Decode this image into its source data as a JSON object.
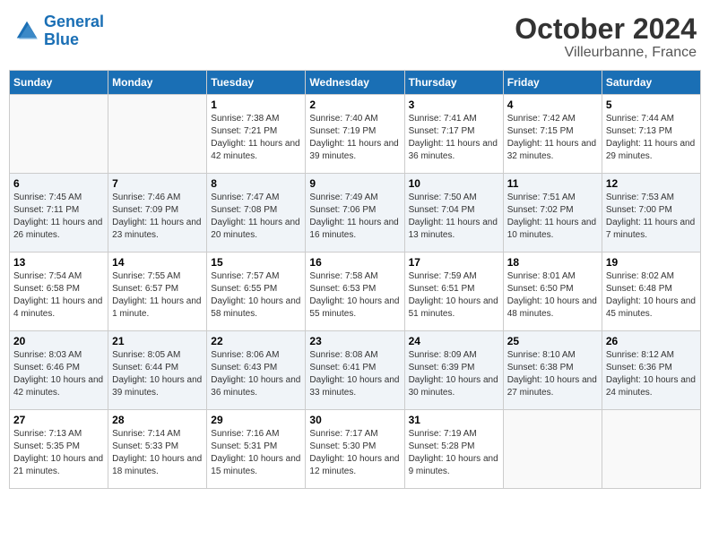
{
  "header": {
    "logo_line1": "General",
    "logo_line2": "Blue",
    "month": "October 2024",
    "location": "Villeurbanne, France"
  },
  "weekdays": [
    "Sunday",
    "Monday",
    "Tuesday",
    "Wednesday",
    "Thursday",
    "Friday",
    "Saturday"
  ],
  "weeks": [
    [
      {
        "day": "",
        "sunrise": "",
        "sunset": "",
        "daylight": ""
      },
      {
        "day": "",
        "sunrise": "",
        "sunset": "",
        "daylight": ""
      },
      {
        "day": "1",
        "sunrise": "Sunrise: 7:38 AM",
        "sunset": "Sunset: 7:21 PM",
        "daylight": "Daylight: 11 hours and 42 minutes."
      },
      {
        "day": "2",
        "sunrise": "Sunrise: 7:40 AM",
        "sunset": "Sunset: 7:19 PM",
        "daylight": "Daylight: 11 hours and 39 minutes."
      },
      {
        "day": "3",
        "sunrise": "Sunrise: 7:41 AM",
        "sunset": "Sunset: 7:17 PM",
        "daylight": "Daylight: 11 hours and 36 minutes."
      },
      {
        "day": "4",
        "sunrise": "Sunrise: 7:42 AM",
        "sunset": "Sunset: 7:15 PM",
        "daylight": "Daylight: 11 hours and 32 minutes."
      },
      {
        "day": "5",
        "sunrise": "Sunrise: 7:44 AM",
        "sunset": "Sunset: 7:13 PM",
        "daylight": "Daylight: 11 hours and 29 minutes."
      }
    ],
    [
      {
        "day": "6",
        "sunrise": "Sunrise: 7:45 AM",
        "sunset": "Sunset: 7:11 PM",
        "daylight": "Daylight: 11 hours and 26 minutes."
      },
      {
        "day": "7",
        "sunrise": "Sunrise: 7:46 AM",
        "sunset": "Sunset: 7:09 PM",
        "daylight": "Daylight: 11 hours and 23 minutes."
      },
      {
        "day": "8",
        "sunrise": "Sunrise: 7:47 AM",
        "sunset": "Sunset: 7:08 PM",
        "daylight": "Daylight: 11 hours and 20 minutes."
      },
      {
        "day": "9",
        "sunrise": "Sunrise: 7:49 AM",
        "sunset": "Sunset: 7:06 PM",
        "daylight": "Daylight: 11 hours and 16 minutes."
      },
      {
        "day": "10",
        "sunrise": "Sunrise: 7:50 AM",
        "sunset": "Sunset: 7:04 PM",
        "daylight": "Daylight: 11 hours and 13 minutes."
      },
      {
        "day": "11",
        "sunrise": "Sunrise: 7:51 AM",
        "sunset": "Sunset: 7:02 PM",
        "daylight": "Daylight: 11 hours and 10 minutes."
      },
      {
        "day": "12",
        "sunrise": "Sunrise: 7:53 AM",
        "sunset": "Sunset: 7:00 PM",
        "daylight": "Daylight: 11 hours and 7 minutes."
      }
    ],
    [
      {
        "day": "13",
        "sunrise": "Sunrise: 7:54 AM",
        "sunset": "Sunset: 6:58 PM",
        "daylight": "Daylight: 11 hours and 4 minutes."
      },
      {
        "day": "14",
        "sunrise": "Sunrise: 7:55 AM",
        "sunset": "Sunset: 6:57 PM",
        "daylight": "Daylight: 11 hours and 1 minute."
      },
      {
        "day": "15",
        "sunrise": "Sunrise: 7:57 AM",
        "sunset": "Sunset: 6:55 PM",
        "daylight": "Daylight: 10 hours and 58 minutes."
      },
      {
        "day": "16",
        "sunrise": "Sunrise: 7:58 AM",
        "sunset": "Sunset: 6:53 PM",
        "daylight": "Daylight: 10 hours and 55 minutes."
      },
      {
        "day": "17",
        "sunrise": "Sunrise: 7:59 AM",
        "sunset": "Sunset: 6:51 PM",
        "daylight": "Daylight: 10 hours and 51 minutes."
      },
      {
        "day": "18",
        "sunrise": "Sunrise: 8:01 AM",
        "sunset": "Sunset: 6:50 PM",
        "daylight": "Daylight: 10 hours and 48 minutes."
      },
      {
        "day": "19",
        "sunrise": "Sunrise: 8:02 AM",
        "sunset": "Sunset: 6:48 PM",
        "daylight": "Daylight: 10 hours and 45 minutes."
      }
    ],
    [
      {
        "day": "20",
        "sunrise": "Sunrise: 8:03 AM",
        "sunset": "Sunset: 6:46 PM",
        "daylight": "Daylight: 10 hours and 42 minutes."
      },
      {
        "day": "21",
        "sunrise": "Sunrise: 8:05 AM",
        "sunset": "Sunset: 6:44 PM",
        "daylight": "Daylight: 10 hours and 39 minutes."
      },
      {
        "day": "22",
        "sunrise": "Sunrise: 8:06 AM",
        "sunset": "Sunset: 6:43 PM",
        "daylight": "Daylight: 10 hours and 36 minutes."
      },
      {
        "day": "23",
        "sunrise": "Sunrise: 8:08 AM",
        "sunset": "Sunset: 6:41 PM",
        "daylight": "Daylight: 10 hours and 33 minutes."
      },
      {
        "day": "24",
        "sunrise": "Sunrise: 8:09 AM",
        "sunset": "Sunset: 6:39 PM",
        "daylight": "Daylight: 10 hours and 30 minutes."
      },
      {
        "day": "25",
        "sunrise": "Sunrise: 8:10 AM",
        "sunset": "Sunset: 6:38 PM",
        "daylight": "Daylight: 10 hours and 27 minutes."
      },
      {
        "day": "26",
        "sunrise": "Sunrise: 8:12 AM",
        "sunset": "Sunset: 6:36 PM",
        "daylight": "Daylight: 10 hours and 24 minutes."
      }
    ],
    [
      {
        "day": "27",
        "sunrise": "Sunrise: 7:13 AM",
        "sunset": "Sunset: 5:35 PM",
        "daylight": "Daylight: 10 hours and 21 minutes."
      },
      {
        "day": "28",
        "sunrise": "Sunrise: 7:14 AM",
        "sunset": "Sunset: 5:33 PM",
        "daylight": "Daylight: 10 hours and 18 minutes."
      },
      {
        "day": "29",
        "sunrise": "Sunrise: 7:16 AM",
        "sunset": "Sunset: 5:31 PM",
        "daylight": "Daylight: 10 hours and 15 minutes."
      },
      {
        "day": "30",
        "sunrise": "Sunrise: 7:17 AM",
        "sunset": "Sunset: 5:30 PM",
        "daylight": "Daylight: 10 hours and 12 minutes."
      },
      {
        "day": "31",
        "sunrise": "Sunrise: 7:19 AM",
        "sunset": "Sunset: 5:28 PM",
        "daylight": "Daylight: 10 hours and 9 minutes."
      },
      {
        "day": "",
        "sunrise": "",
        "sunset": "",
        "daylight": ""
      },
      {
        "day": "",
        "sunrise": "",
        "sunset": "",
        "daylight": ""
      }
    ]
  ]
}
